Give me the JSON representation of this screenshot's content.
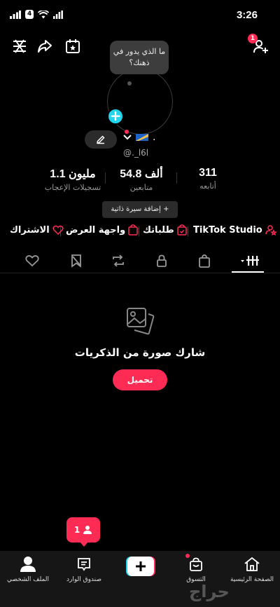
{
  "status_bar": {
    "signal_badge": "4",
    "time": "3:26"
  },
  "top_bar": {
    "notification_count": "1"
  },
  "avatar": {
    "thought_bubble": "ما الذي يدور في ذهنك؟"
  },
  "profile": {
    "display_name": ".",
    "username": "@._l6l"
  },
  "stats": [
    {
      "value": "311",
      "label": "أتابعه"
    },
    {
      "value": "54.8 ألف",
      "label": "متابعين"
    },
    {
      "value": "1.1 مليون",
      "label": "تسجيلات الإعجاب"
    }
  ],
  "add_bio": "إضافة سيرة ذاتية",
  "links": {
    "studio": "TikTok Studio",
    "orders": "طلباتك",
    "showcase": "واجهة العرض",
    "subscription": "الاشتراك"
  },
  "empty_state": {
    "title": "شارك صورة من الذكريات",
    "button": "تحميل"
  },
  "follow_tip": {
    "count": "1"
  },
  "bottom_nav": {
    "home": "الصفحة الرئيسية",
    "shop": "التسوق",
    "inbox": "صندوق الوارد",
    "profile": "الملف الشخصي"
  },
  "colors": {
    "accent": "#fe2c55",
    "cyan": "#20d5ec",
    "background": "#000000"
  },
  "watermark": "حراج"
}
